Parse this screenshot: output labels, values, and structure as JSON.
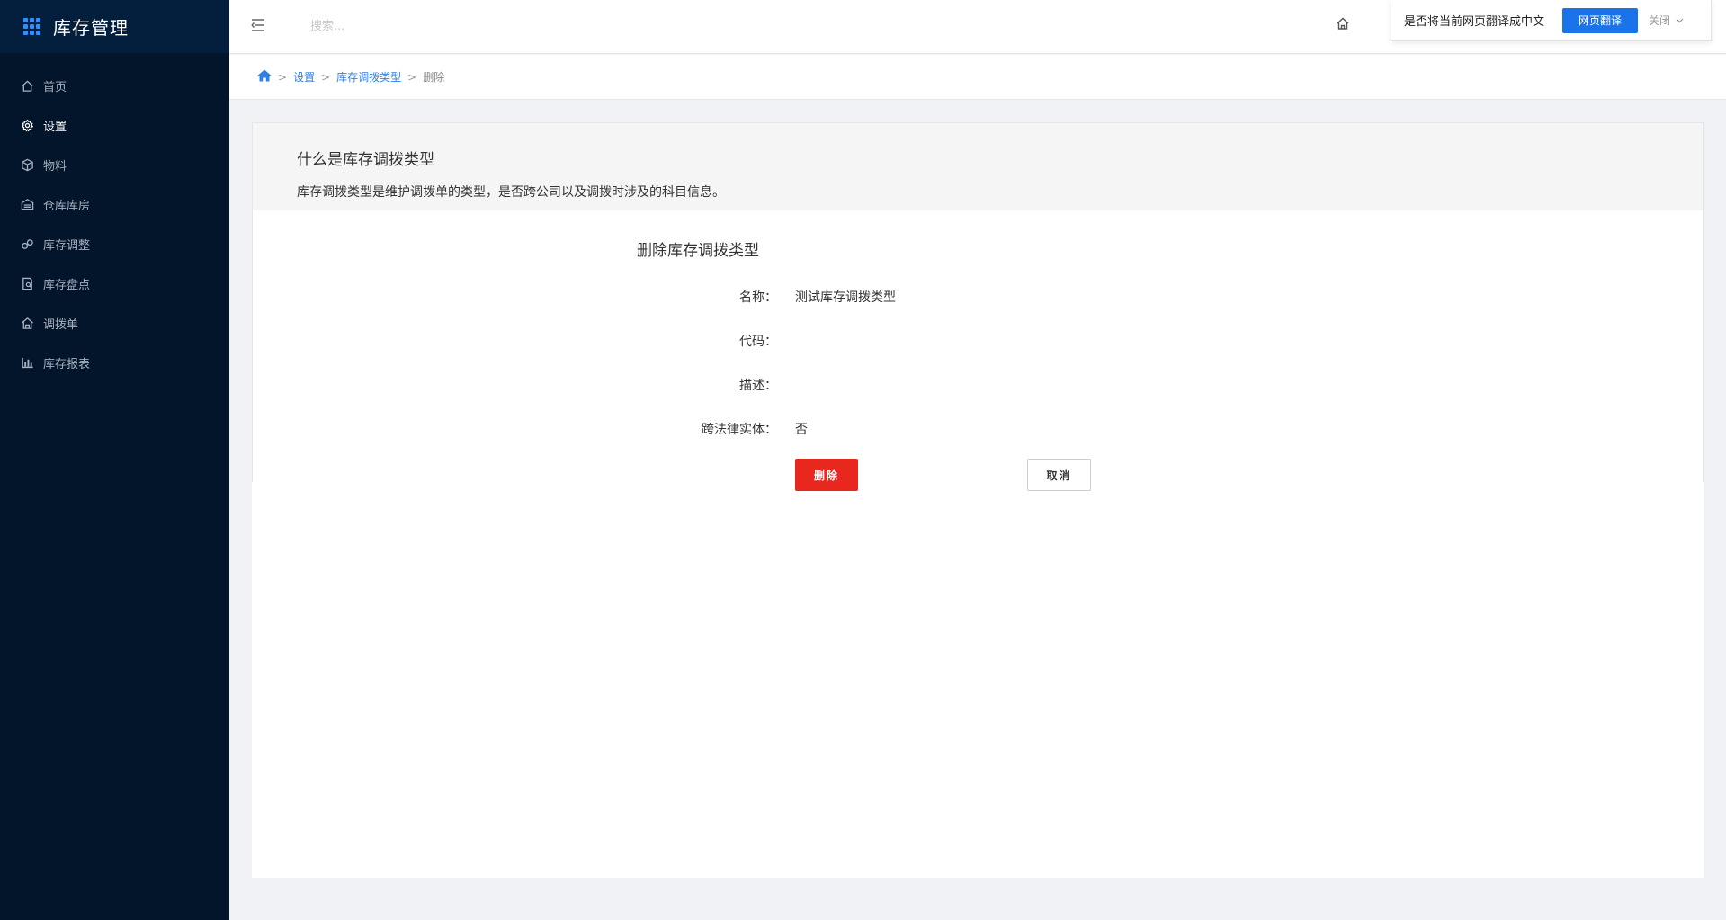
{
  "app": {
    "title": "库存管理"
  },
  "sidebar": {
    "items": [
      {
        "label": "首页",
        "icon": "home-icon"
      },
      {
        "label": "设置",
        "icon": "gear-icon",
        "active": true
      },
      {
        "label": "物料",
        "icon": "cube-icon"
      },
      {
        "label": "仓库库房",
        "icon": "warehouse-icon"
      },
      {
        "label": "库存调整",
        "icon": "adjust-icon"
      },
      {
        "label": "库存盘点",
        "icon": "inventory-check-icon"
      },
      {
        "label": "调拨单",
        "icon": "transfer-icon"
      },
      {
        "label": "库存报表",
        "icon": "bar-chart-icon"
      }
    ]
  },
  "header": {
    "search_placeholder": "搜索...",
    "translate": {
      "prompt": "是否将当前网页翻译成中文",
      "button": "网页翻译",
      "close": "关闭"
    }
  },
  "breadcrumb": {
    "items": [
      "设置",
      "库存调拨类型"
    ],
    "current": "删除"
  },
  "intro": {
    "title": "什么是库存调拨类型",
    "description": "库存调拨类型是维护调拨单的类型，是否跨公司以及调拨时涉及的科目信息。"
  },
  "form": {
    "title": "删除库存调拨类型",
    "fields": [
      {
        "label": "名称：",
        "value": "测试库存调拨类型"
      },
      {
        "label": "代码：",
        "value": ""
      },
      {
        "label": "描述：",
        "value": ""
      },
      {
        "label": "跨法律实体：",
        "value": "否"
      }
    ],
    "delete_label": "删除",
    "cancel_label": "取消"
  },
  "colors": {
    "sidebar_bg": "#03152b",
    "accent": "#2f7fe6",
    "danger": "#e8281f",
    "translate_btn": "#1a73e8"
  }
}
